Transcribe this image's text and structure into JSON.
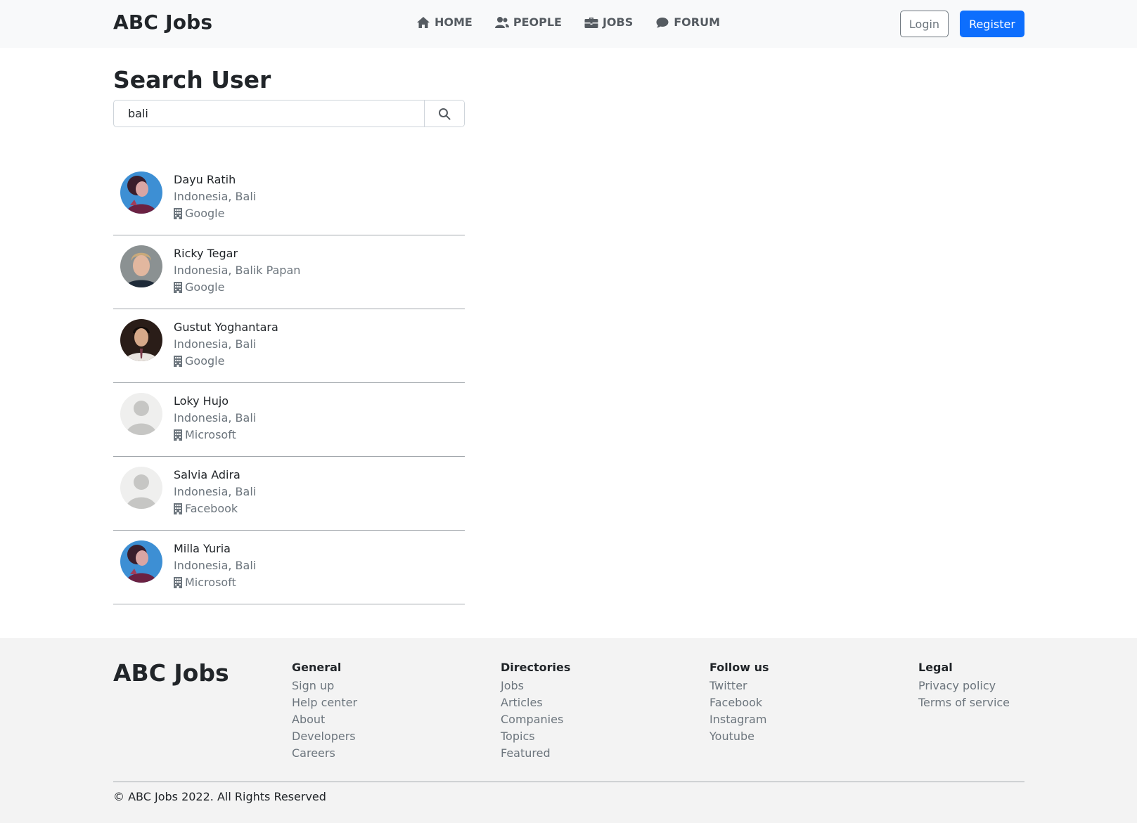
{
  "nav": {
    "brand": "ABC Jobs",
    "links": [
      {
        "label": "HOME",
        "icon": "home-icon"
      },
      {
        "label": "PEOPLE",
        "icon": "people-icon"
      },
      {
        "label": "JOBS",
        "icon": "briefcase-icon"
      },
      {
        "label": "FORUM",
        "icon": "chat-icon"
      }
    ],
    "login_label": "Login",
    "register_label": "Register"
  },
  "search": {
    "title": "Search User",
    "query": "bali"
  },
  "users": [
    {
      "name": "Dayu Ratih",
      "location": "Indonesia, Bali",
      "company": "Google",
      "avatar": "photo-woman-blue"
    },
    {
      "name": "Ricky Tegar",
      "location": "Indonesia, Balik Papan",
      "company": "Google",
      "avatar": "photo-man-blond"
    },
    {
      "name": "Gustut Yoghantara",
      "location": "Indonesia, Bali",
      "company": "Google",
      "avatar": "photo-man-dark"
    },
    {
      "name": "Loky Hujo",
      "location": "Indonesia, Bali",
      "company": "Microsoft",
      "avatar": "default-avatar"
    },
    {
      "name": "Salvia Adira",
      "location": "Indonesia, Bali",
      "company": "Facebook",
      "avatar": "default-avatar"
    },
    {
      "name": "Milla Yuria",
      "location": "Indonesia, Bali",
      "company": "Microsoft",
      "avatar": "photo-woman-blue"
    }
  ],
  "footer": {
    "brand": "ABC Jobs",
    "columns": [
      {
        "title": "General",
        "links": [
          "Sign up",
          "Help center",
          "About",
          "Developers",
          "Careers"
        ]
      },
      {
        "title": "Directories",
        "links": [
          "Jobs",
          "Articles",
          "Companies",
          "Topics",
          "Featured"
        ]
      },
      {
        "title": "Follow us",
        "links": [
          "Twitter",
          "Facebook",
          "Instagram",
          "Youtube"
        ]
      },
      {
        "title": "Legal",
        "links": [
          "Privacy policy",
          "Terms of service"
        ]
      }
    ],
    "copyright": "© ABC Jobs 2022. All Rights Reserved"
  },
  "colors": {
    "primary": "#0d6efd",
    "navbar_bg": "#f8f9fa",
    "footer_bg": "#f3f3f3",
    "muted_text": "#6c757d"
  }
}
